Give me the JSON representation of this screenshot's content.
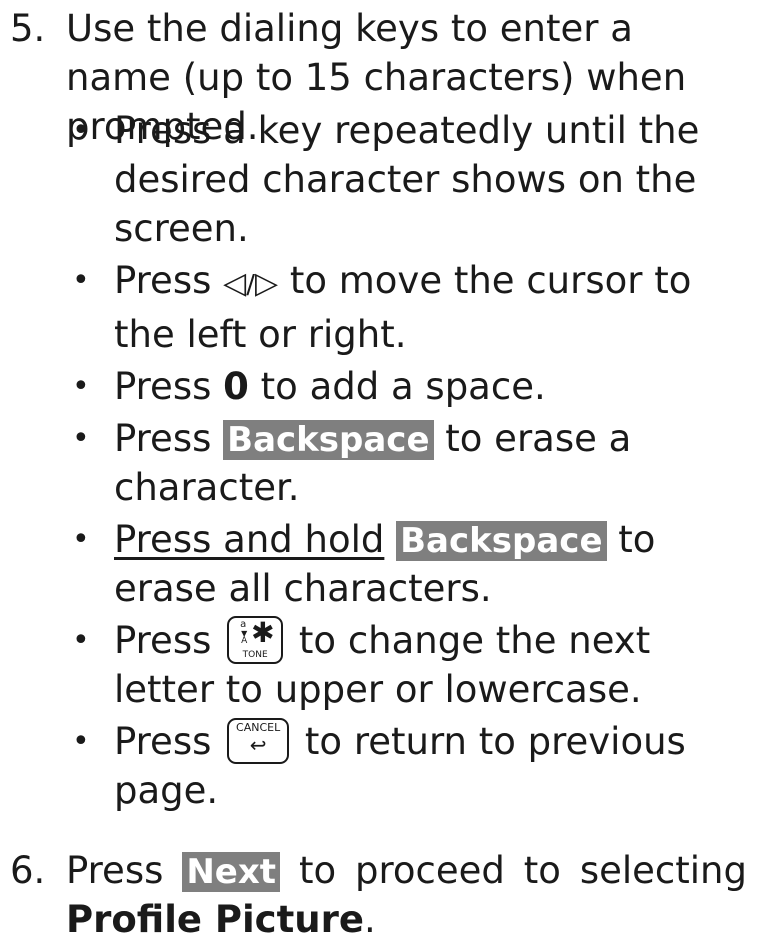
{
  "step5": {
    "number": "5.",
    "text": "Use the dialing keys to enter a name (up to 15 characters) when prompted."
  },
  "bullets": {
    "b1": "Press a key repeatedly until the desired character shows on the screen.",
    "b2_press": "Press",
    "b2_left_arrow": "◁",
    "b2_slash": "/",
    "b2_right_arrow": "▷",
    "b2_rest": "to move the cursor to the left or right.",
    "b3_press": "Press",
    "b3_key": "0",
    "b3_rest": "to add a space.",
    "b4_press": "Press",
    "b4_key": "Backspace",
    "b4_rest": "to erase a character.",
    "b5_underlined": "Press and hold",
    "b5_key": "Backspace",
    "b5_rest": "to erase all characters.",
    "b6_press": "Press",
    "b6_rest": "to change the next letter to upper or lowercase.",
    "b7_press": "Press",
    "b7_rest": "to return to previous page."
  },
  "tone_key": {
    "a": "a",
    "arrow": "▼",
    "A": "A",
    "star": "✱",
    "tone": "TONE"
  },
  "cancel_key": {
    "label": "CANCEL",
    "arrow": "↩"
  },
  "step6": {
    "number": "6.",
    "press": "Press",
    "key": "Next",
    "text": "to proceed to selecting",
    "target": "Profile Picture",
    "period": "."
  },
  "colors": {
    "key_background": "#7f7f7f",
    "key_text": "#ffffff",
    "text": "#1a1a1a"
  }
}
